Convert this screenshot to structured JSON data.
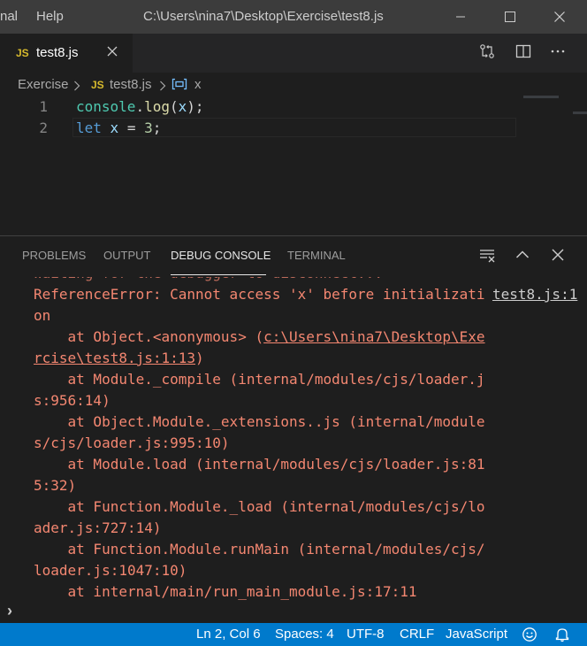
{
  "titlebar": {
    "menu_partial": "nal",
    "menu_help": "Help",
    "title": "C:\\Users\\nina7\\Desktop\\Exercise\\test8.js"
  },
  "tab": {
    "lang_badge": "JS",
    "name": "test8.js"
  },
  "breadcrumb": {
    "folder": "Exercise",
    "file_badge": "JS",
    "file": "test8.js",
    "symbol": "x"
  },
  "editor": {
    "lines": [
      {
        "number": "1",
        "code": "console.log(x);"
      },
      {
        "number": "2",
        "code": "let x = 3;"
      }
    ]
  },
  "panel": {
    "tabs": [
      "PROBLEMS",
      "OUTPUT",
      "DEBUG CONSOLE",
      "TERMINAL"
    ],
    "active_tab": "DEBUG CONSOLE",
    "console": {
      "faded_line": "Waiting for the debugger to disconnect...",
      "error_line1": "ReferenceError: Cannot access 'x' before initializati",
      "error_line2": "on",
      "source_link": "test8.js:1",
      "stack": [
        "    at Object.<anonymous> (",
        "c:\\Users\\nina7\\Desktop\\Exe",
        "rcise\\test8.js:1:13",
        ")",
        "    at Module._compile (internal/modules/cjs/loader.j",
        "s:956:14)",
        "    at Object.Module._extensions..js (internal/module",
        "s/cjs/loader.js:995:10)",
        "    at Module.load (internal/modules/cjs/loader.js:81",
        "5:32)",
        "    at Function.Module._load (internal/modules/cjs/lo",
        "ader.js:727:14)",
        "    at Function.Module.runMain (internal/modules/cjs/",
        "loader.js:1047:10)",
        "    at internal/main/run_main_module.js:17:11"
      ]
    },
    "prompt": "›"
  },
  "statusbar": {
    "position": "Ln 2, Col 6",
    "indent": "Spaces: 4",
    "encoding": "UTF-8",
    "eol": "CRLF",
    "language": "JavaScript"
  },
  "colors": {
    "statusbar": "#007acc",
    "error_text": "#f48771",
    "js_badge": "#d7ba2d"
  },
  "icons": [
    "minimize-icon",
    "maximize-icon",
    "close-icon",
    "compare-changes-icon",
    "split-editor-icon",
    "more-actions-icon",
    "chevron-right-icon",
    "variable-icon",
    "clear-console-icon",
    "chevron-up-icon",
    "feedback-icon",
    "bell-icon"
  ]
}
